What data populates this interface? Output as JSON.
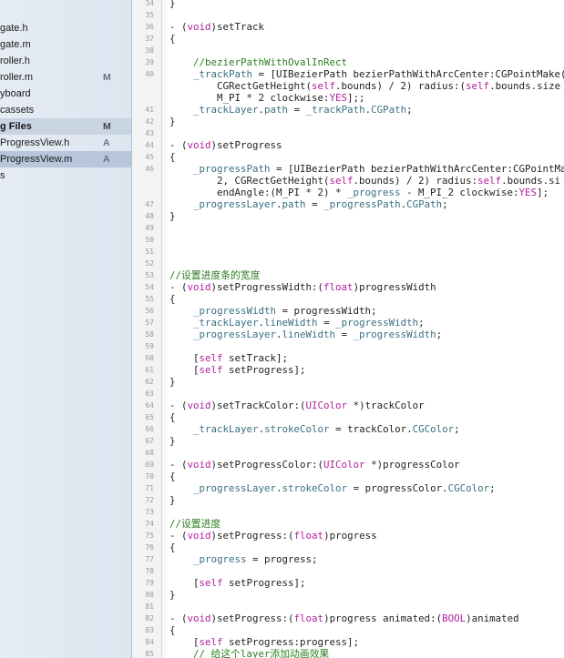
{
  "navigator": {
    "items": [
      {
        "label": "gate.h",
        "badge": ""
      },
      {
        "label": "gate.m",
        "badge": ""
      },
      {
        "label": "roller.h",
        "badge": ""
      },
      {
        "label": "roller.m",
        "badge": "M"
      },
      {
        "label": "yboard",
        "badge": ""
      },
      {
        "label": "cassets",
        "badge": ""
      },
      {
        "label": "g Files",
        "badge": "M",
        "kind": "group"
      },
      {
        "label": "ProgressView.h",
        "badge": "A"
      },
      {
        "label": "ProgressView.m",
        "badge": "A",
        "kind": "selected"
      },
      {
        "label": "s",
        "badge": ""
      }
    ]
  },
  "editor": {
    "lines": [
      {
        "n": "34",
        "parts": [
          [
            "p",
            "}"
          ]
        ]
      },
      {
        "n": "35",
        "parts": []
      },
      {
        "n": "36",
        "parts": [
          [
            "p",
            "- ("
          ],
          [
            "k",
            "void"
          ],
          [
            "p",
            ")setTrack"
          ]
        ]
      },
      {
        "n": "37",
        "parts": [
          [
            "p",
            "{"
          ]
        ]
      },
      {
        "n": "38",
        "parts": []
      },
      {
        "n": "39",
        "parts": [
          [
            "p",
            "    "
          ],
          [
            "c",
            "//bezierPathWithOvalInRect"
          ]
        ]
      },
      {
        "n": "40",
        "parts": [
          [
            "p",
            "    "
          ],
          [
            "i",
            "_trackPath"
          ],
          [
            "p",
            " = [UIBezierPath bezierPathWithArcCenter:CGPointMake("
          ]
        ]
      },
      {
        "n": "",
        "parts": [
          [
            "p",
            "        CGRectGetHeight("
          ],
          [
            "k",
            "self"
          ],
          [
            "p",
            ".bounds) / 2) radius:("
          ],
          [
            "k",
            "self"
          ],
          [
            "p",
            ".bounds.size"
          ]
        ]
      },
      {
        "n": "",
        "parts": [
          [
            "p",
            "        M_PI * 2 clockwise:"
          ],
          [
            "k",
            "YES"
          ],
          [
            "p",
            "];;"
          ]
        ]
      },
      {
        "n": "41",
        "parts": [
          [
            "p",
            "    "
          ],
          [
            "i",
            "_trackLayer"
          ],
          [
            "p",
            "."
          ],
          [
            "i",
            "path"
          ],
          [
            "p",
            " = "
          ],
          [
            "i",
            "_trackPath"
          ],
          [
            "p",
            "."
          ],
          [
            "i",
            "CGPath"
          ],
          [
            "p",
            ";"
          ]
        ]
      },
      {
        "n": "42",
        "parts": [
          [
            "p",
            "}"
          ]
        ]
      },
      {
        "n": "43",
        "parts": []
      },
      {
        "n": "44",
        "parts": [
          [
            "p",
            "- ("
          ],
          [
            "k",
            "void"
          ],
          [
            "p",
            ")setProgress"
          ]
        ]
      },
      {
        "n": "45",
        "parts": [
          [
            "p",
            "{"
          ]
        ]
      },
      {
        "n": "46",
        "parts": [
          [
            "p",
            "    "
          ],
          [
            "i",
            "_progressPath"
          ],
          [
            "p",
            " = [UIBezierPath bezierPathWithArcCenter:CGPointMa"
          ]
        ]
      },
      {
        "n": "",
        "parts": [
          [
            "p",
            "        2, CGRectGetHeight("
          ],
          [
            "k",
            "self"
          ],
          [
            "p",
            ".bounds) / 2) radius:"
          ],
          [
            "k",
            "self"
          ],
          [
            "p",
            ".bounds.si"
          ]
        ]
      },
      {
        "n": "",
        "parts": [
          [
            "p",
            "        endAngle:(M_PI * 2) * "
          ],
          [
            "i",
            "_progress"
          ],
          [
            "p",
            " - M_PI_2 clockwise:"
          ],
          [
            "k",
            "YES"
          ],
          [
            "p",
            "];"
          ]
        ]
      },
      {
        "n": "47",
        "parts": [
          [
            "p",
            "    "
          ],
          [
            "i",
            "_progressLayer"
          ],
          [
            "p",
            "."
          ],
          [
            "i",
            "path"
          ],
          [
            "p",
            " = "
          ],
          [
            "i",
            "_progressPath"
          ],
          [
            "p",
            "."
          ],
          [
            "i",
            "CGPath"
          ],
          [
            "p",
            ";"
          ]
        ]
      },
      {
        "n": "48",
        "parts": [
          [
            "p",
            "}"
          ]
        ]
      },
      {
        "n": "49",
        "parts": []
      },
      {
        "n": "50",
        "parts": []
      },
      {
        "n": "51",
        "parts": []
      },
      {
        "n": "52",
        "parts": []
      },
      {
        "n": "53",
        "parts": [
          [
            "c",
            "//设置进度条的宽度"
          ]
        ]
      },
      {
        "n": "54",
        "parts": [
          [
            "p",
            "- ("
          ],
          [
            "k",
            "void"
          ],
          [
            "p",
            ")setProgressWidth:("
          ],
          [
            "k",
            "float"
          ],
          [
            "p",
            ")progressWidth"
          ]
        ]
      },
      {
        "n": "55",
        "parts": [
          [
            "p",
            "{"
          ]
        ]
      },
      {
        "n": "56",
        "parts": [
          [
            "p",
            "    "
          ],
          [
            "i",
            "_progressWidth"
          ],
          [
            "p",
            " = progressWidth;"
          ]
        ]
      },
      {
        "n": "57",
        "parts": [
          [
            "p",
            "    "
          ],
          [
            "i",
            "_trackLayer"
          ],
          [
            "p",
            "."
          ],
          [
            "i",
            "lineWidth"
          ],
          [
            "p",
            " = "
          ],
          [
            "i",
            "_progressWidth"
          ],
          [
            "p",
            ";"
          ]
        ]
      },
      {
        "n": "58",
        "parts": [
          [
            "p",
            "    "
          ],
          [
            "i",
            "_progressLayer"
          ],
          [
            "p",
            "."
          ],
          [
            "i",
            "lineWidth"
          ],
          [
            "p",
            " = "
          ],
          [
            "i",
            "_progressWidth"
          ],
          [
            "p",
            ";"
          ]
        ]
      },
      {
        "n": "59",
        "parts": []
      },
      {
        "n": "60",
        "parts": [
          [
            "p",
            "    ["
          ],
          [
            "k",
            "self"
          ],
          [
            "p",
            " setTrack];"
          ]
        ]
      },
      {
        "n": "61",
        "parts": [
          [
            "p",
            "    ["
          ],
          [
            "k",
            "self"
          ],
          [
            "p",
            " setProgress];"
          ]
        ]
      },
      {
        "n": "62",
        "parts": [
          [
            "p",
            "}"
          ]
        ]
      },
      {
        "n": "63",
        "parts": []
      },
      {
        "n": "64",
        "parts": [
          [
            "p",
            "- ("
          ],
          [
            "k",
            "void"
          ],
          [
            "p",
            ")setTrackColor:("
          ],
          [
            "k",
            "UIColor"
          ],
          [
            "p",
            " *)trackColor"
          ]
        ]
      },
      {
        "n": "65",
        "parts": [
          [
            "p",
            "{"
          ]
        ]
      },
      {
        "n": "66",
        "parts": [
          [
            "p",
            "    "
          ],
          [
            "i",
            "_trackLayer"
          ],
          [
            "p",
            "."
          ],
          [
            "i",
            "strokeColor"
          ],
          [
            "p",
            " = trackColor."
          ],
          [
            "i",
            "CGColor"
          ],
          [
            "p",
            ";"
          ]
        ]
      },
      {
        "n": "67",
        "parts": [
          [
            "p",
            "}"
          ]
        ]
      },
      {
        "n": "68",
        "parts": []
      },
      {
        "n": "69",
        "parts": [
          [
            "p",
            "- ("
          ],
          [
            "k",
            "void"
          ],
          [
            "p",
            ")setProgressColor:("
          ],
          [
            "k",
            "UIColor"
          ],
          [
            "p",
            " *)progressColor"
          ]
        ]
      },
      {
        "n": "70",
        "parts": [
          [
            "p",
            "{"
          ]
        ]
      },
      {
        "n": "71",
        "parts": [
          [
            "p",
            "    "
          ],
          [
            "i",
            "_progressLayer"
          ],
          [
            "p",
            "."
          ],
          [
            "i",
            "strokeColor"
          ],
          [
            "p",
            " = progressColor."
          ],
          [
            "i",
            "CGColor"
          ],
          [
            "p",
            ";"
          ]
        ]
      },
      {
        "n": "72",
        "parts": [
          [
            "p",
            "}"
          ]
        ]
      },
      {
        "n": "73",
        "parts": []
      },
      {
        "n": "74",
        "parts": [
          [
            "c",
            "//设置进度"
          ]
        ]
      },
      {
        "n": "75",
        "parts": [
          [
            "p",
            "- ("
          ],
          [
            "k",
            "void"
          ],
          [
            "p",
            ")setProgress:("
          ],
          [
            "k",
            "float"
          ],
          [
            "p",
            ")progress"
          ]
        ]
      },
      {
        "n": "76",
        "parts": [
          [
            "p",
            "{"
          ]
        ]
      },
      {
        "n": "77",
        "parts": [
          [
            "p",
            "    "
          ],
          [
            "i",
            "_progress"
          ],
          [
            "p",
            " = progress;"
          ]
        ]
      },
      {
        "n": "78",
        "parts": []
      },
      {
        "n": "79",
        "parts": [
          [
            "p",
            "    ["
          ],
          [
            "k",
            "self"
          ],
          [
            "p",
            " setProgress];"
          ]
        ]
      },
      {
        "n": "80",
        "parts": [
          [
            "p",
            "}"
          ]
        ]
      },
      {
        "n": "81",
        "parts": []
      },
      {
        "n": "82",
        "parts": [
          [
            "p",
            "- ("
          ],
          [
            "k",
            "void"
          ],
          [
            "p",
            ")setProgress:("
          ],
          [
            "k",
            "float"
          ],
          [
            "p",
            ")progress animated:("
          ],
          [
            "k",
            "BOOL"
          ],
          [
            "p",
            ")animated"
          ]
        ]
      },
      {
        "n": "83",
        "parts": [
          [
            "p",
            "{"
          ]
        ]
      },
      {
        "n": "84",
        "parts": [
          [
            "p",
            "    ["
          ],
          [
            "k",
            "self"
          ],
          [
            "p",
            " setProgress:progress];"
          ]
        ]
      },
      {
        "n": "85",
        "parts": [
          [
            "p",
            "    "
          ],
          [
            "c",
            "// 给这个layer添加动画效果"
          ]
        ]
      }
    ]
  },
  "colors": {
    "keyword": "#b3209e",
    "comment": "#2e7d22",
    "ivar": "#3a6f82"
  }
}
